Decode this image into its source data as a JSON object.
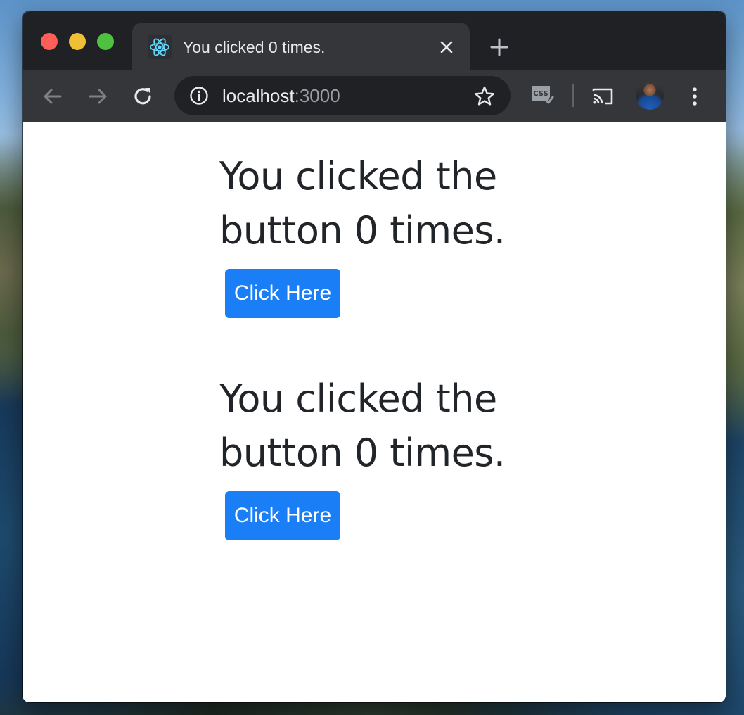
{
  "browser": {
    "tab": {
      "title": "You clicked 0 times.",
      "favicon": "react-logo-icon"
    },
    "omnibox": {
      "host": "localhost",
      "port": ":3000"
    },
    "icons": {
      "back": "arrow-left-icon",
      "forward": "arrow-right-icon",
      "reload": "reload-icon",
      "info": "info-icon",
      "bookmark": "star-icon",
      "extension": "css-extension-icon",
      "cast": "cast-icon",
      "menu": "kebab-menu-icon"
    }
  },
  "page": {
    "counters": [
      {
        "text": "You clicked the button 0 times.",
        "button_label": "Click Here"
      },
      {
        "text": "You clicked the button 0 times.",
        "button_label": "Click Here"
      }
    ]
  },
  "colors": {
    "button": "#1a7ef7",
    "text": "#212529",
    "react_accent": "#61dafb"
  }
}
